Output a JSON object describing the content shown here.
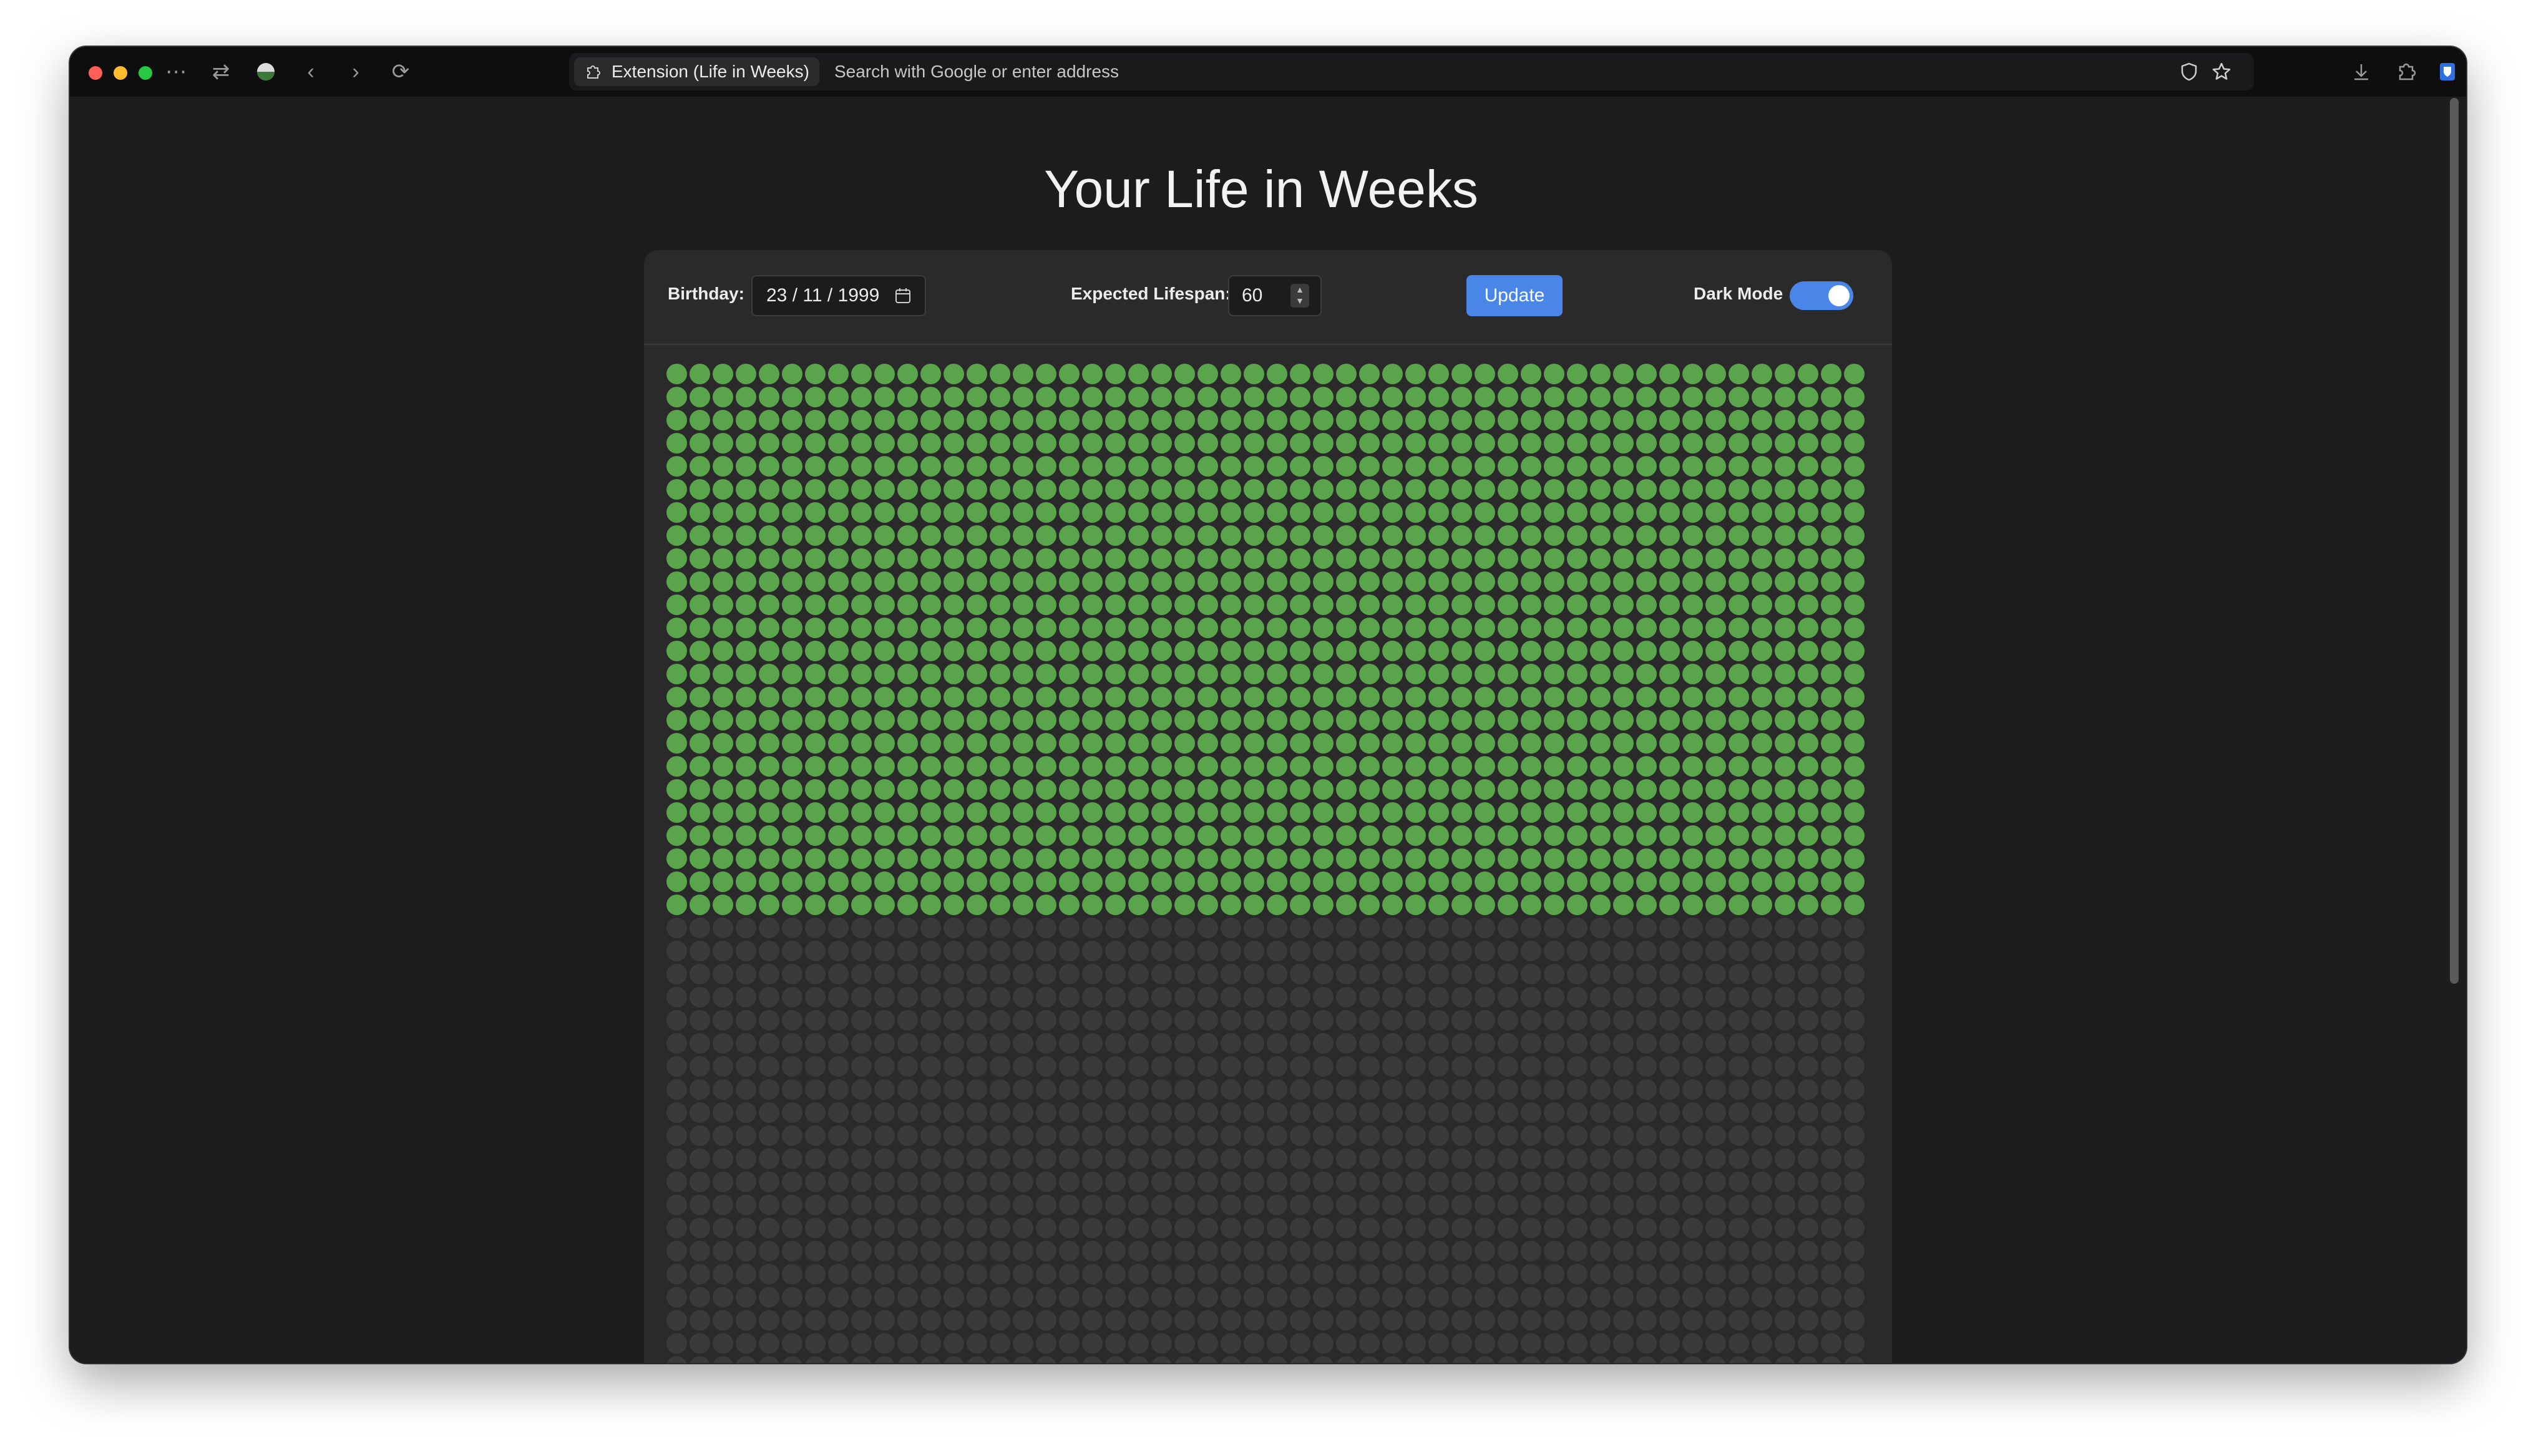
{
  "browser": {
    "extension_pill_label": "Extension (Life in Weeks)",
    "url_placeholder": "Search with Google or enter address"
  },
  "page": {
    "title": "Your Life in Weeks"
  },
  "controls": {
    "birthday_label": "Birthday:",
    "birthday_value": "23 / 11 / 1999",
    "lifespan_label": "Expected Lifespan:",
    "lifespan_value": "60",
    "update_label": "Update",
    "dark_mode_label": "Dark Mode",
    "dark_mode_on": true
  },
  "weeks": {
    "columns": 52,
    "lived": 1248,
    "visible_rows": 46,
    "lived_color": "#5aa54c",
    "future_color": "#3a3a3a"
  },
  "colors": {
    "accent": "#4a86e8",
    "background": "#1c1c1c",
    "card": "#2a2a2a"
  }
}
